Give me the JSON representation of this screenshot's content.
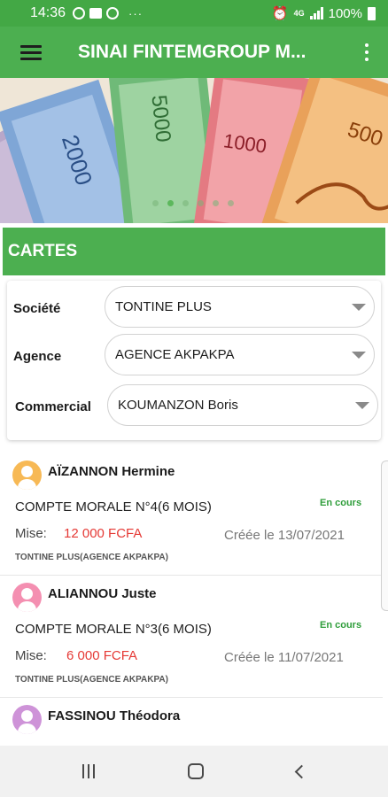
{
  "status_bar": {
    "time": "14:36",
    "battery": "100%",
    "network": "4G",
    "overflow": "···"
  },
  "app_bar": {
    "title": "SINAI FINTEMGROUP M..."
  },
  "banner": {
    "active_slide": 1,
    "slide_count": 6
  },
  "section": {
    "title": "CARTES"
  },
  "filters": {
    "societe": {
      "label": "Société",
      "value": "TONTINE PLUS"
    },
    "agence": {
      "label": "Agence",
      "value": "AGENCE AKPAKPA"
    },
    "commercial": {
      "label": "Commercial",
      "value": "KOUMANZON Boris"
    }
  },
  "cards": [
    {
      "name": "AÏZANNON Hermine",
      "account": "COMPTE MORALE N°4(6 MOIS)",
      "status": "En cours",
      "mise_label": "Mise:",
      "mise_value": "12 000 FCFA",
      "created": "Créée le 13/07/2021",
      "agency": "TONTINE PLUS(AGENCE AKPAKPA)",
      "avatar_color": "#f7b955"
    },
    {
      "name": "ALIANNOU Juste",
      "account": "COMPTE MORALE N°3(6 MOIS)",
      "status": "En cours",
      "mise_label": "Mise:",
      "mise_value": "6 000 FCFA",
      "created": "Créée le 11/07/2021",
      "agency": "TONTINE PLUS(AGENCE AKPAKPA)",
      "avatar_color": "#f48fb1"
    },
    {
      "name": "FASSINOU Théodora",
      "avatar_color": "#ce93d8"
    }
  ],
  "colors": {
    "primary": "#4caf50",
    "status_bar": "#43a845",
    "mise": "#e53935",
    "status_text": "#2e9d3a"
  },
  "banknote_denominations": [
    "2000",
    "5000",
    "1000",
    "500"
  ]
}
